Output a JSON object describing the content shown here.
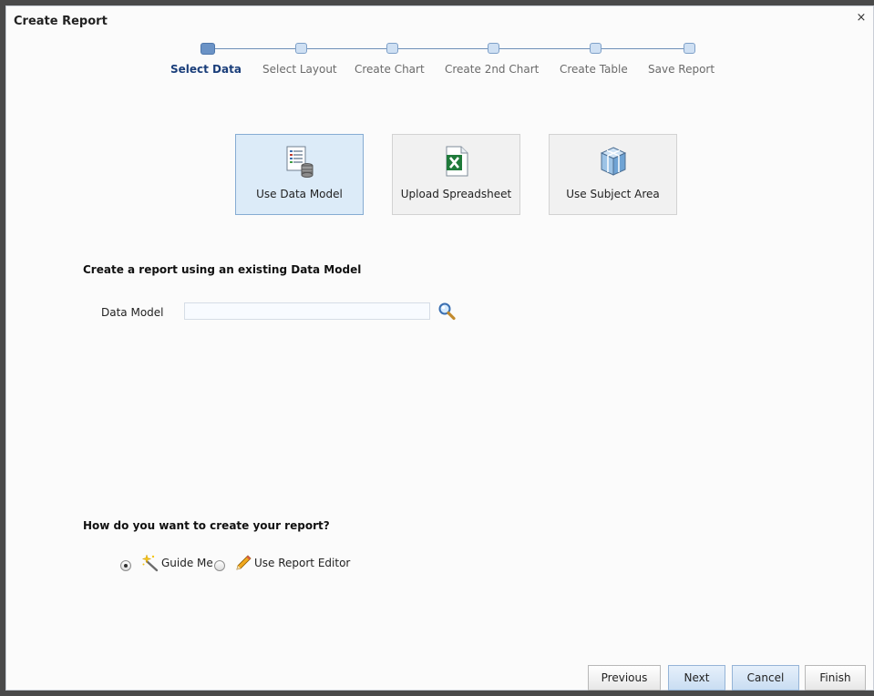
{
  "dialog": {
    "title": "Create Report",
    "close_glyph": "×"
  },
  "train": {
    "steps": [
      {
        "label": "Select Data",
        "active": true
      },
      {
        "label": "Select Layout",
        "active": false
      },
      {
        "label": "Create Chart",
        "active": false
      },
      {
        "label": "Create 2nd Chart",
        "active": false
      },
      {
        "label": "Create Table",
        "active": false
      },
      {
        "label": "Save Report",
        "active": false
      }
    ]
  },
  "sources": [
    {
      "label": "Use Data Model",
      "icon": "data-model-icon",
      "selected": true
    },
    {
      "label": "Upload Spreadsheet",
      "icon": "excel-spreadsheet-icon",
      "selected": false
    },
    {
      "label": "Use Subject Area",
      "icon": "subject-area-cube-icon",
      "selected": false
    }
  ],
  "data_model_section": {
    "heading": "Create a report using an existing Data Model",
    "field_label": "Data Model",
    "value": "",
    "search_icon": "magnifier-search-icon"
  },
  "method_section": {
    "heading": "How do you want to create your report?",
    "options": [
      {
        "label": "Guide Me",
        "icon": "magic-wand-icon",
        "checked": true
      },
      {
        "label": "Use Report Editor",
        "icon": "pencil-icon",
        "checked": false
      }
    ]
  },
  "footer": {
    "previous": "Previous",
    "next": "Next",
    "cancel": "Cancel",
    "finish": "Finish"
  },
  "colors": {
    "accent": "#1a3e7a",
    "selected_tile": "#dcebf8",
    "primary_button": "#c9ddf2"
  }
}
